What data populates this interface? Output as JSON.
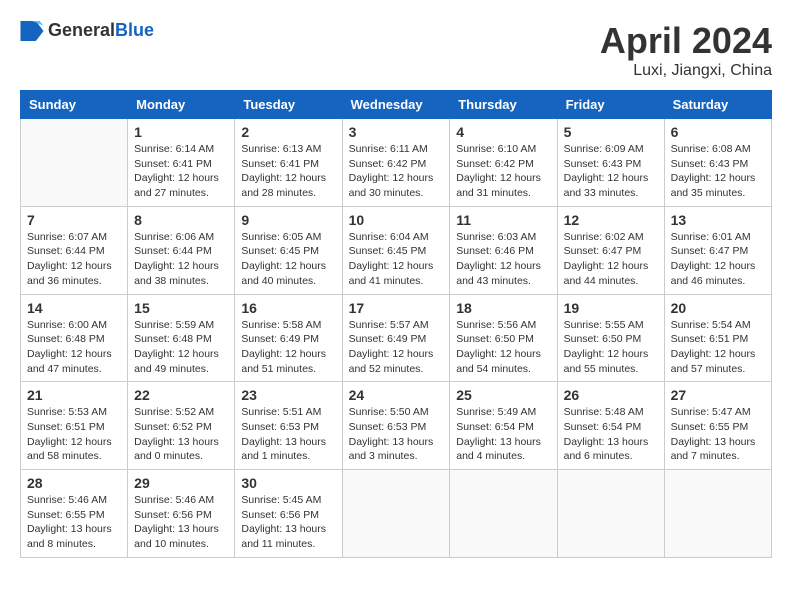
{
  "header": {
    "logo_general": "General",
    "logo_blue": "Blue",
    "month_title": "April 2024",
    "location": "Luxi, Jiangxi, China"
  },
  "calendar": {
    "days_of_week": [
      "Sunday",
      "Monday",
      "Tuesday",
      "Wednesday",
      "Thursday",
      "Friday",
      "Saturday"
    ],
    "weeks": [
      [
        {
          "day": "",
          "info": ""
        },
        {
          "day": "1",
          "info": "Sunrise: 6:14 AM\nSunset: 6:41 PM\nDaylight: 12 hours\nand 27 minutes."
        },
        {
          "day": "2",
          "info": "Sunrise: 6:13 AM\nSunset: 6:41 PM\nDaylight: 12 hours\nand 28 minutes."
        },
        {
          "day": "3",
          "info": "Sunrise: 6:11 AM\nSunset: 6:42 PM\nDaylight: 12 hours\nand 30 minutes."
        },
        {
          "day": "4",
          "info": "Sunrise: 6:10 AM\nSunset: 6:42 PM\nDaylight: 12 hours\nand 31 minutes."
        },
        {
          "day": "5",
          "info": "Sunrise: 6:09 AM\nSunset: 6:43 PM\nDaylight: 12 hours\nand 33 minutes."
        },
        {
          "day": "6",
          "info": "Sunrise: 6:08 AM\nSunset: 6:43 PM\nDaylight: 12 hours\nand 35 minutes."
        }
      ],
      [
        {
          "day": "7",
          "info": "Sunrise: 6:07 AM\nSunset: 6:44 PM\nDaylight: 12 hours\nand 36 minutes."
        },
        {
          "day": "8",
          "info": "Sunrise: 6:06 AM\nSunset: 6:44 PM\nDaylight: 12 hours\nand 38 minutes."
        },
        {
          "day": "9",
          "info": "Sunrise: 6:05 AM\nSunset: 6:45 PM\nDaylight: 12 hours\nand 40 minutes."
        },
        {
          "day": "10",
          "info": "Sunrise: 6:04 AM\nSunset: 6:45 PM\nDaylight: 12 hours\nand 41 minutes."
        },
        {
          "day": "11",
          "info": "Sunrise: 6:03 AM\nSunset: 6:46 PM\nDaylight: 12 hours\nand 43 minutes."
        },
        {
          "day": "12",
          "info": "Sunrise: 6:02 AM\nSunset: 6:47 PM\nDaylight: 12 hours\nand 44 minutes."
        },
        {
          "day": "13",
          "info": "Sunrise: 6:01 AM\nSunset: 6:47 PM\nDaylight: 12 hours\nand 46 minutes."
        }
      ],
      [
        {
          "day": "14",
          "info": "Sunrise: 6:00 AM\nSunset: 6:48 PM\nDaylight: 12 hours\nand 47 minutes."
        },
        {
          "day": "15",
          "info": "Sunrise: 5:59 AM\nSunset: 6:48 PM\nDaylight: 12 hours\nand 49 minutes."
        },
        {
          "day": "16",
          "info": "Sunrise: 5:58 AM\nSunset: 6:49 PM\nDaylight: 12 hours\nand 51 minutes."
        },
        {
          "day": "17",
          "info": "Sunrise: 5:57 AM\nSunset: 6:49 PM\nDaylight: 12 hours\nand 52 minutes."
        },
        {
          "day": "18",
          "info": "Sunrise: 5:56 AM\nSunset: 6:50 PM\nDaylight: 12 hours\nand 54 minutes."
        },
        {
          "day": "19",
          "info": "Sunrise: 5:55 AM\nSunset: 6:50 PM\nDaylight: 12 hours\nand 55 minutes."
        },
        {
          "day": "20",
          "info": "Sunrise: 5:54 AM\nSunset: 6:51 PM\nDaylight: 12 hours\nand 57 minutes."
        }
      ],
      [
        {
          "day": "21",
          "info": "Sunrise: 5:53 AM\nSunset: 6:51 PM\nDaylight: 12 hours\nand 58 minutes."
        },
        {
          "day": "22",
          "info": "Sunrise: 5:52 AM\nSunset: 6:52 PM\nDaylight: 13 hours\nand 0 minutes."
        },
        {
          "day": "23",
          "info": "Sunrise: 5:51 AM\nSunset: 6:53 PM\nDaylight: 13 hours\nand 1 minutes."
        },
        {
          "day": "24",
          "info": "Sunrise: 5:50 AM\nSunset: 6:53 PM\nDaylight: 13 hours\nand 3 minutes."
        },
        {
          "day": "25",
          "info": "Sunrise: 5:49 AM\nSunset: 6:54 PM\nDaylight: 13 hours\nand 4 minutes."
        },
        {
          "day": "26",
          "info": "Sunrise: 5:48 AM\nSunset: 6:54 PM\nDaylight: 13 hours\nand 6 minutes."
        },
        {
          "day": "27",
          "info": "Sunrise: 5:47 AM\nSunset: 6:55 PM\nDaylight: 13 hours\nand 7 minutes."
        }
      ],
      [
        {
          "day": "28",
          "info": "Sunrise: 5:46 AM\nSunset: 6:55 PM\nDaylight: 13 hours\nand 8 minutes."
        },
        {
          "day": "29",
          "info": "Sunrise: 5:46 AM\nSunset: 6:56 PM\nDaylight: 13 hours\nand 10 minutes."
        },
        {
          "day": "30",
          "info": "Sunrise: 5:45 AM\nSunset: 6:56 PM\nDaylight: 13 hours\nand 11 minutes."
        },
        {
          "day": "",
          "info": ""
        },
        {
          "day": "",
          "info": ""
        },
        {
          "day": "",
          "info": ""
        },
        {
          "day": "",
          "info": ""
        }
      ]
    ]
  }
}
